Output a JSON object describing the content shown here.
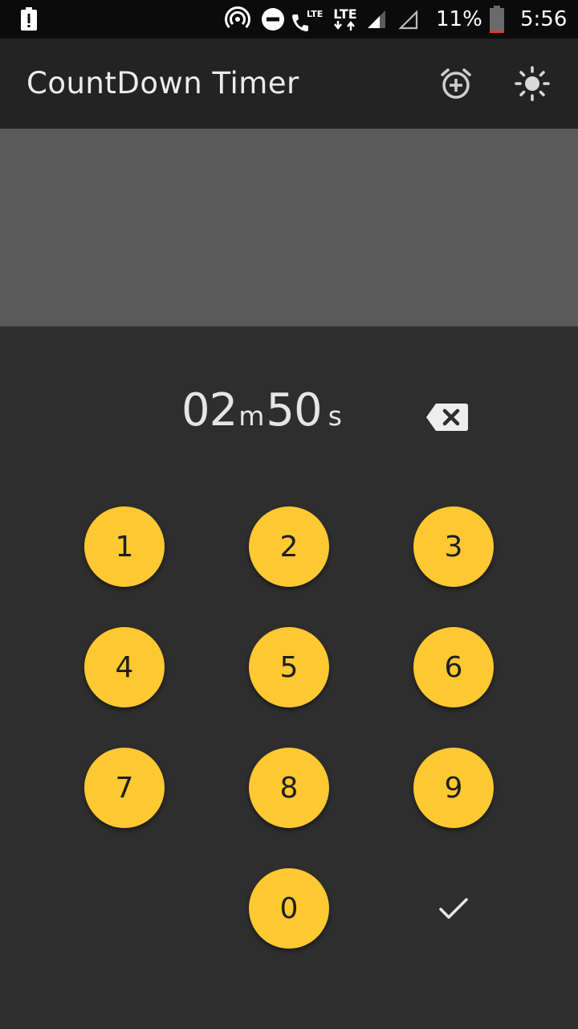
{
  "status_bar": {
    "lte_call_label": "LTE",
    "lte_data_label": "LTE",
    "battery_percent": "11%",
    "time": "5:56",
    "battery_level": 0.11,
    "battery_low_color": "#e53935"
  },
  "app_bar": {
    "title": "CountDown Timer",
    "icons": [
      "alarm-add-icon",
      "brightness-icon"
    ]
  },
  "timer": {
    "minutes": "02",
    "minutes_unit": "m",
    "seconds": "50",
    "seconds_unit": "s"
  },
  "keypad": {
    "keys": [
      "1",
      "2",
      "3",
      "4",
      "5",
      "6",
      "7",
      "8",
      "9",
      "0"
    ],
    "confirm_icon": "checkmark-icon",
    "backspace_icon": "backspace-icon"
  },
  "colors": {
    "accent": "#fdc831",
    "background": "#2e2e2e",
    "app_bar": "#232323",
    "panel": "#5a5a5a",
    "status_bar": "#0b0b0b"
  }
}
